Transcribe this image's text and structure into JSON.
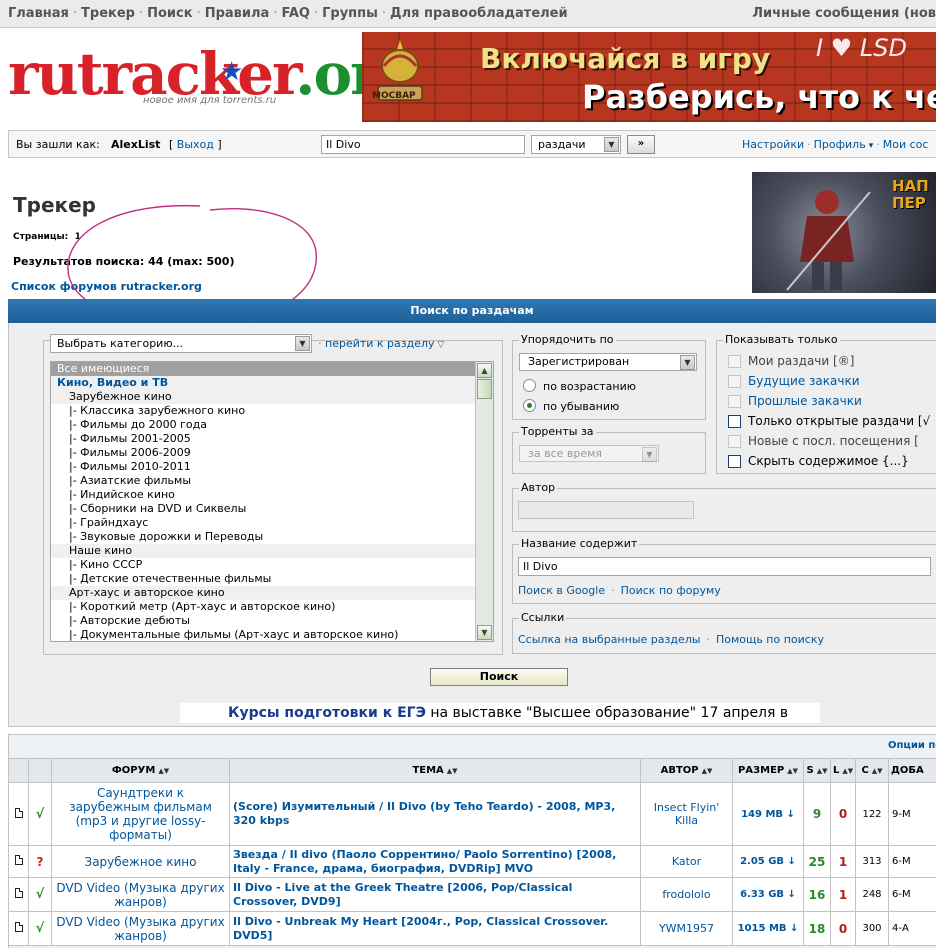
{
  "topnav": {
    "items": [
      "Главная",
      "Трекер",
      "Поиск",
      "Правила",
      "FAQ",
      "Группы",
      "Для правообладателей"
    ],
    "separator": "·",
    "right": "Личные сообщения (нов"
  },
  "logo": {
    "part1": "rutracker",
    "part2": "org",
    "tagline": "новое имя для torrents.ru"
  },
  "banner": {
    "line1": "Включайся в игру",
    "line2": "Разберись, что к чему",
    "badge": "МОСВАР",
    "corner": "I ♥ LSD"
  },
  "login": {
    "label": "Вы зашли как:",
    "user": "AlexList",
    "exit_open": "[",
    "exit": "Выход",
    "exit_close": "]",
    "search_value": "Il Divo",
    "search_type": "раздачи",
    "go": "»",
    "links": [
      "Настройки",
      "Профиль",
      "Мои сос"
    ]
  },
  "page": {
    "title": "Трекер",
    "pages_label": "Страницы:",
    "pages_value": "1",
    "results": "Результатов поиска: 44 (max: 500)",
    "forum_list_link": "Список форумов rutracker.org"
  },
  "side_ad": {
    "text_line1": "НАП",
    "text_line2": "ПЕР"
  },
  "search_panel": {
    "header": "Поиск по раздачам",
    "category_select": "Выбрать категорию...",
    "goto_section": "перейти к разделу",
    "categories": [
      {
        "label": "Все имеющиеся",
        "kind": "all"
      },
      {
        "label": "Кино, Видео и ТВ",
        "kind": "group"
      },
      {
        "label": "Зарубежное кино",
        "kind": "sub"
      },
      {
        "label": "|- Классика зарубежного кино",
        "kind": "item"
      },
      {
        "label": "|- Фильмы до 2000 года",
        "kind": "item"
      },
      {
        "label": "|- Фильмы 2001-2005",
        "kind": "item"
      },
      {
        "label": "|- Фильмы 2006-2009",
        "kind": "item"
      },
      {
        "label": "|- Фильмы 2010-2011",
        "kind": "item"
      },
      {
        "label": "|- Азиатские фильмы",
        "kind": "item"
      },
      {
        "label": "|- Индийское кино",
        "kind": "item"
      },
      {
        "label": "|- Сборники на DVD и Сиквелы",
        "kind": "item"
      },
      {
        "label": "|- Грайндхаус",
        "kind": "item"
      },
      {
        "label": "|- Звуковые дорожки и Переводы",
        "kind": "item"
      },
      {
        "label": "Наше кино",
        "kind": "sub"
      },
      {
        "label": "|- Кино СССР",
        "kind": "item"
      },
      {
        "label": "|- Детские отечественные фильмы",
        "kind": "item"
      },
      {
        "label": "Арт-хаус и авторское кино",
        "kind": "sub"
      },
      {
        "label": "|- Короткий метр (Арт-хаус и авторское кино)",
        "kind": "item"
      },
      {
        "label": "|- Авторские дебюты",
        "kind": "item"
      },
      {
        "label": "|- Документальные фильмы (Арт-хаус и авторское кино)",
        "kind": "item"
      }
    ],
    "order": {
      "legend": "Упорядочить по",
      "selected": "Зарегистрирован",
      "asc": "по возрастанию",
      "desc": "по убыванию"
    },
    "period": {
      "legend": "Торренты за",
      "selected": "за все время"
    },
    "show_only": {
      "legend": "Показывать только",
      "options": [
        {
          "label": "Мои раздачи [®]",
          "enabled": false,
          "link": false
        },
        {
          "label": "Будущие закачки",
          "enabled": false,
          "link": true
        },
        {
          "label": "Прошлые закачки",
          "enabled": false,
          "link": true
        },
        {
          "label": "Только открытые раздачи [√",
          "enabled": true,
          "link": false
        },
        {
          "label": "Новые с посл. посещения [",
          "enabled": false,
          "link": false
        },
        {
          "label": "Скрыть содержимое {...}",
          "enabled": true,
          "link": false
        }
      ]
    },
    "author": {
      "legend": "Автор",
      "value": ""
    },
    "title": {
      "legend": "Название содержит",
      "value": "Il Divo",
      "google": "Поиск в Google",
      "forum": "Поиск по форуму"
    },
    "links": {
      "legend": "Ссылки",
      "selected": "Ссылка на выбранные разделы",
      "help": "Помощь по поиску"
    },
    "search_button": "Поиск"
  },
  "ad_line": {
    "big": "Курсы подготовки к ЕГЭ",
    "rest": " на выставке \"Высшее образование\" 17 апреля в"
  },
  "results": {
    "options": "Опции по",
    "headers": [
      "ФОРУМ",
      "ТЕМА",
      "АВТОР",
      "РАЗМЕР",
      "S",
      "L",
      "C",
      "ДОБА"
    ],
    "rows": [
      {
        "status": "√",
        "forum": "Саундтреки к зарубежным фильмам (mp3 и другие lossy-форматы)",
        "topic": "(Score) Изумительный / Il Divo (by Teho Teardo) - 2008, MP3, 320 kbps",
        "author": "Insect Flyin' Killa",
        "size": "149 MB ↓",
        "seeds": "9",
        "leech": "0",
        "comp": "122",
        "added": "9-М"
      },
      {
        "status": "?",
        "forum": "Зарубежное кино",
        "topic": "Звезда / Il divo (Паоло Соррентино/ Paolo Sorrentino) [2008, Italy - France, драма, биография, DVDRip] MVO",
        "author": "Kator",
        "size": "2.05 GB ↓",
        "seeds": "25",
        "leech": "1",
        "comp": "313",
        "added": "6-М"
      },
      {
        "status": "√",
        "forum": "DVD Video (Музыка других жанров)",
        "topic": "Il Divo - Live at the Greek Theatre [2006, Pop/Classical Crossover, DVD9]",
        "author": "frodololo",
        "size": "6.33 GB ↓",
        "seeds": "16",
        "leech": "1",
        "comp": "248",
        "added": "6-М"
      },
      {
        "status": "√",
        "forum": "DVD Video (Музыка других жанров)",
        "topic": "Il Divo - Unbreak My Heart [2004г., Pop, Classical Crossover. DVD5]",
        "author": "YWM1957",
        "size": "1015 MB ↓",
        "seeds": "18",
        "leech": "0",
        "comp": "300",
        "added": "4-А"
      }
    ]
  },
  "colors": {
    "link": "#00569c",
    "panel_header": "#2f78b4",
    "seeds": "#2a8a2a",
    "leech": "#b91c1c",
    "logo_red": "#d8222a",
    "logo_green": "#1c8f2e"
  }
}
